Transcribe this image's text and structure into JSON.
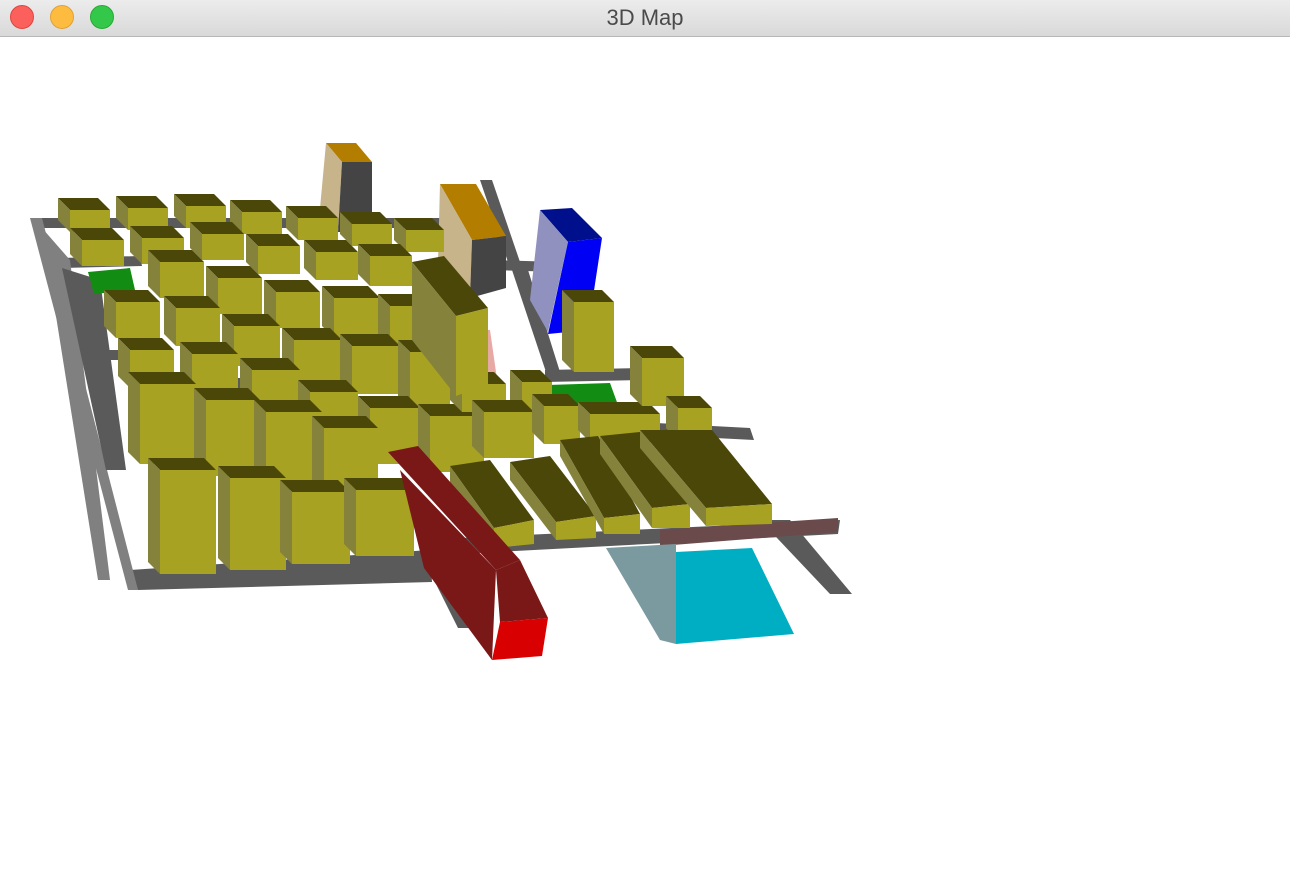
{
  "window": {
    "title": "3D Map",
    "buttons": {
      "close": "close",
      "minimize": "minimize",
      "zoom": "zoom"
    }
  },
  "scene": {
    "background": "#ffffff",
    "colors": {
      "road": "#5a5a5a",
      "road_light": "#808080",
      "building_top": "#4a4708",
      "building_front": "#a8a222",
      "building_side": "#85823c",
      "park": "#128c12",
      "tower_blue_top": "#000f8c",
      "tower_blue_front": "#0000f5",
      "tower_blue_side": "#9191c0",
      "tower_orange_top": "#b37d00",
      "tower_orange_side": "#c8b48a",
      "tower_gray": "#444444",
      "red_block": "#d80000",
      "red_block_side": "#7a1818",
      "cyan_plane": "#00aec4",
      "cyan_plane_side": "#7a9aa0",
      "pink_road": "#e6a9a4",
      "maroon_road": "#6a4a4a"
    },
    "objects": [
      "road-grid",
      "yellow-buildings",
      "blue-tower",
      "orange-tower",
      "brown-tower",
      "red-block",
      "cyan-plane",
      "green-parks"
    ]
  }
}
